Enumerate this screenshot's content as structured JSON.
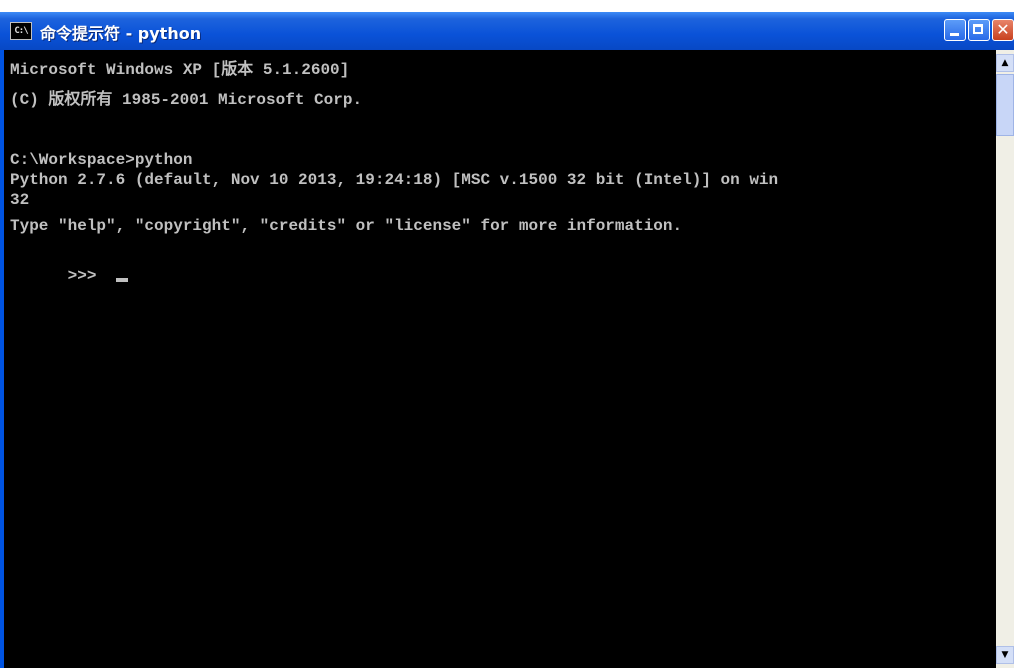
{
  "window": {
    "title": "命令提示符 - python",
    "icon_label": "C:\\",
    "minimize_symbol": "_",
    "maximize_symbol": "□",
    "close_symbol": "✕"
  },
  "console": {
    "lines": [
      "Microsoft Windows XP [版本 5.1.2600]",
      "(C) 版权所有 1985-2001 Microsoft Corp.",
      "",
      "C:\\Workspace>python",
      "Python 2.7.6 (default, Nov 10 2013, 19:24:18) [MSC v.1500 32 bit (Intel)] on win",
      "32",
      "Type \"help\", \"copyright\", \"credits\" or \"license\" for more information.",
      ">>> "
    ],
    "text_color": "#c0c0c0",
    "background_color": "#000000"
  },
  "scrollbar": {
    "up_arrow": "▲",
    "down_arrow": "▼"
  }
}
